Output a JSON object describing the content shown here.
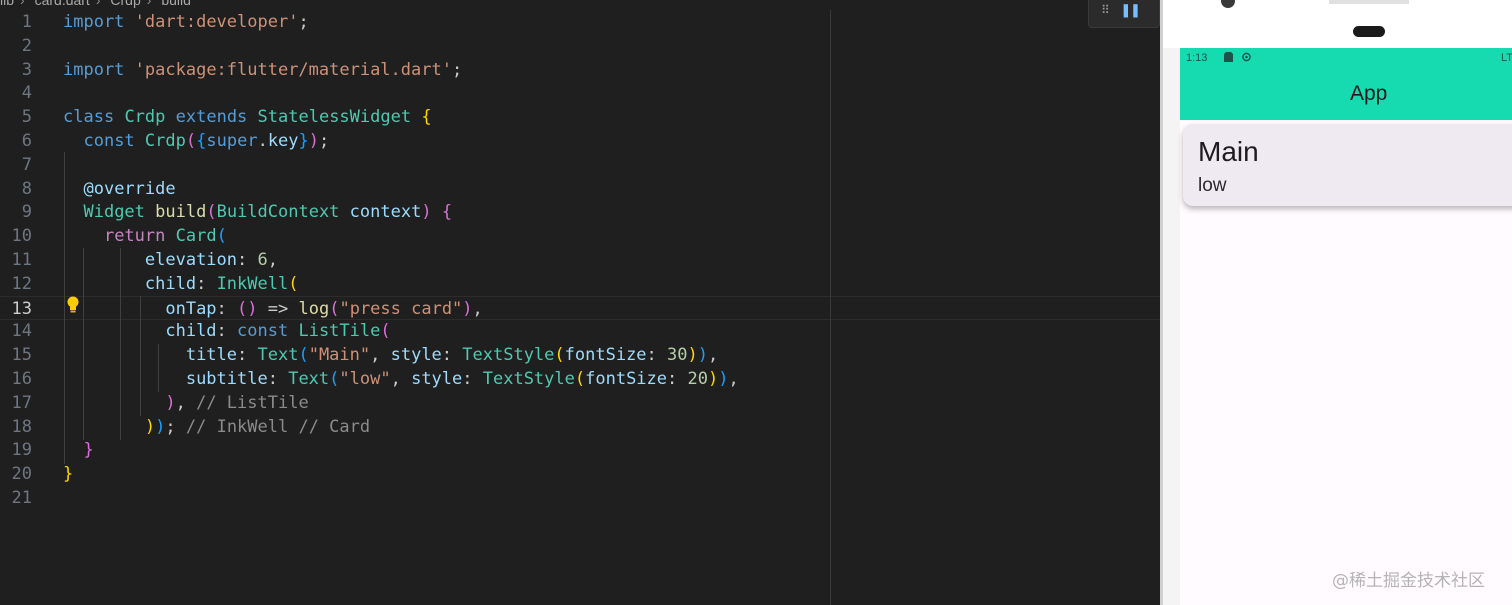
{
  "breadcrumb": {
    "items": [
      "lib",
      "card.dart",
      "Crdp",
      "build"
    ]
  },
  "editor": {
    "active_line": 13,
    "lines": [
      {
        "n": "1",
        "html": "<span class='kw'>import</span> <span class='str'>'dart:developer'</span><span class='pn'>;</span>"
      },
      {
        "n": "2",
        "html": ""
      },
      {
        "n": "3",
        "html": "<span class='kw'>import</span> <span class='str'>'package:flutter/material.dart'</span><span class='pn'>;</span>"
      },
      {
        "n": "4",
        "html": ""
      },
      {
        "n": "5",
        "html": "<span class='kw'>class</span> <span class='ty'>Crdp</span> <span class='kw'>extends</span> <span class='ty'>StatelessWidget</span> <span class='b1'>{</span>"
      },
      {
        "n": "6",
        "html": "  <span class='kw'>const</span> <span class='ty'>Crdp</span><span class='b2'>(</span><span class='b3'>{</span><span class='kw'>super</span><span class='pn'>.</span><span class='var'>key</span><span class='b3'>}</span><span class='b2'>)</span><span class='pn'>;</span>"
      },
      {
        "n": "7",
        "html": ""
      },
      {
        "n": "8",
        "html": "  <span class='var'>@override</span>"
      },
      {
        "n": "9",
        "html": "  <span class='ty'>Widget</span> <span class='fn'>build</span><span class='b2'>(</span><span class='ty'>BuildContext</span> <span class='var'>context</span><span class='b2'>)</span> <span class='b2'>{</span>"
      },
      {
        "n": "10",
        "html": "    <span class='kw2'>return</span> <span class='ty'>Card</span><span class='b3'>(</span>"
      },
      {
        "n": "11",
        "html": "        <span class='var'>elevation</span><span class='pn'>: </span><span class='num'>6</span><span class='pn'>,</span>"
      },
      {
        "n": "12",
        "html": "        <span class='var'>child</span><span class='pn'>: </span><span class='ty'>InkWell</span><span class='b1'>(</span>"
      },
      {
        "n": "13",
        "html": "          <span class='var'>onTap</span><span class='pn'>: </span><span class='b2'>()</span> <span class='pn'>=&gt;</span> <span class='fn'>log</span><span class='b2'>(</span><span class='str'>\"press card\"</span><span class='b2'>)</span><span class='pn'>,</span>"
      },
      {
        "n": "14",
        "html": "          <span class='var'>child</span><span class='pn'>: </span><span class='kw'>const</span> <span class='ty'>ListTile</span><span class='b2'>(</span>"
      },
      {
        "n": "15",
        "html": "            <span class='var'>title</span><span class='pn'>: </span><span class='ty'>Text</span><span class='b3'>(</span><span class='str'>\"Main\"</span><span class='pn'>, </span><span class='var'>style</span><span class='pn'>: </span><span class='ty'>TextStyle</span><span class='b1'>(</span><span class='var'>fontSize</span><span class='pn'>: </span><span class='num'>30</span><span class='b1'>)</span><span class='b3'>)</span><span class='pn'>,</span>"
      },
      {
        "n": "16",
        "html": "            <span class='var'>subtitle</span><span class='pn'>: </span><span class='ty'>Text</span><span class='b3'>(</span><span class='str'>\"low\"</span><span class='pn'>, </span><span class='var'>style</span><span class='pn'>: </span><span class='ty'>TextStyle</span><span class='b1'>(</span><span class='var'>fontSize</span><span class='pn'>: </span><span class='num'>20</span><span class='b1'>)</span><span class='b3'>)</span><span class='pn'>,</span>"
      },
      {
        "n": "17",
        "html": "          <span class='b2'>)</span><span class='pn'>, </span><span class='cm'>// ListTile</span>"
      },
      {
        "n": "18",
        "html": "        <span class='b1'>)</span><span class='b3'>)</span><span class='pn'>; </span><span class='cm'>// InkWell // Card</span>"
      },
      {
        "n": "19",
        "html": "  <span class='b2'>}</span>"
      },
      {
        "n": "20",
        "html": "<span class='b1'>}</span>"
      },
      {
        "n": "21",
        "html": ""
      }
    ]
  },
  "phone": {
    "status_time": "1:13",
    "status_right": "LT",
    "appbar_title": "App",
    "card_title": "Main",
    "card_subtitle": "low"
  },
  "watermark": "@稀土掘金技术社区",
  "colors": {
    "accent": "#16dbb0",
    "editor_bg": "#1f1f1f",
    "card_bg": "#efe9f2"
  }
}
